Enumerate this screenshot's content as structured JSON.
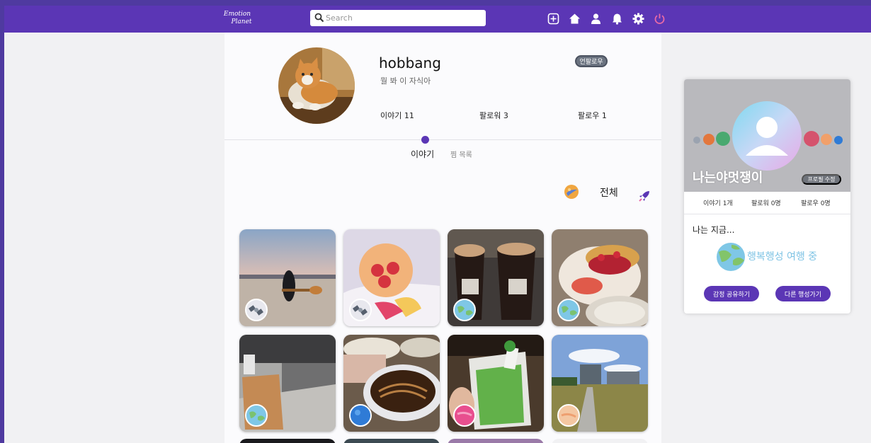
{
  "header": {
    "logo_line1": "Emotion",
    "logo_line2": "Planet",
    "search_placeholder": "Search",
    "icons": [
      "add-icon",
      "home-icon",
      "user-icon",
      "bell-icon",
      "gear-icon",
      "power-icon"
    ]
  },
  "profile": {
    "username": "hobbang",
    "bio": "뭘 봐 이 자식아",
    "unfollow_label": "언팔로우",
    "stats": {
      "stories": "이야기 11",
      "followers": "팔로워 3",
      "following": "팔로우 1"
    }
  },
  "tabs": {
    "story": "이야기",
    "saved": "찜 목록"
  },
  "filter": {
    "label": "전체"
  },
  "widget": {
    "name": "나는야멋쟁이",
    "edit_label": "프로필 수정",
    "stats": {
      "stories": "이야기 1개",
      "followers": "팔로워 0명",
      "following": "팔로우 0명"
    },
    "now_label": "나는 지금...",
    "planet_status": "행복행성 여행 중",
    "share_button": "감정 공유하기",
    "other_planet_button": "다른 행성가기"
  },
  "colors": {
    "brand": "#5b36b5",
    "planet_text": "#7ec3e4"
  }
}
